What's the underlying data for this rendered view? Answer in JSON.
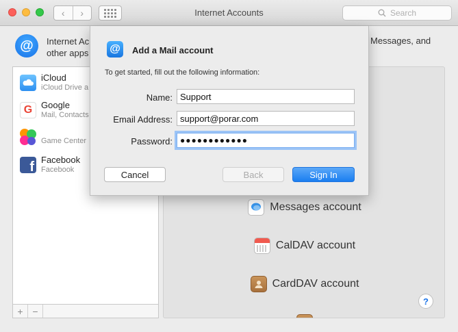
{
  "window": {
    "title": "Internet Accounts",
    "search_placeholder": "Search"
  },
  "header": {
    "text_left_line1": "Internet Ac",
    "text_left_line2": "other apps",
    "text_right": "Messages, and"
  },
  "accounts": [
    {
      "name": "iCloud",
      "sub": "iCloud Drive a",
      "icon": "icloud-icon"
    },
    {
      "name": "Google",
      "sub": "Mail, Contacts",
      "icon": "google-icon"
    },
    {
      "name": "",
      "sub": "Game Center",
      "icon": "game-center-icon"
    },
    {
      "name": "Facebook",
      "sub": "Facebook",
      "icon": "facebook-icon"
    }
  ],
  "list_footer": {
    "add": "+",
    "remove": "−"
  },
  "providers": [
    {
      "label": "Messages account",
      "icon": "messages-icon"
    },
    {
      "label": "CalDAV account",
      "icon": "calendar-icon"
    },
    {
      "label": "CardDAV account",
      "icon": "contacts-icon"
    }
  ],
  "help_label": "?",
  "sheet": {
    "title": "Add a Mail account",
    "instructions": "To get started, fill out the following information:",
    "fields": {
      "name_label": "Name:",
      "name_value": "Support",
      "email_label": "Email Address:",
      "email_value": "support@porar.com",
      "password_label": "Password:",
      "password_value": "●●●●●●●●●●●●"
    },
    "buttons": {
      "cancel": "Cancel",
      "back": "Back",
      "signin": "Sign In"
    }
  },
  "colors": {
    "accent": "#1a7ef0",
    "focus_ring": "#9cc4f6"
  }
}
